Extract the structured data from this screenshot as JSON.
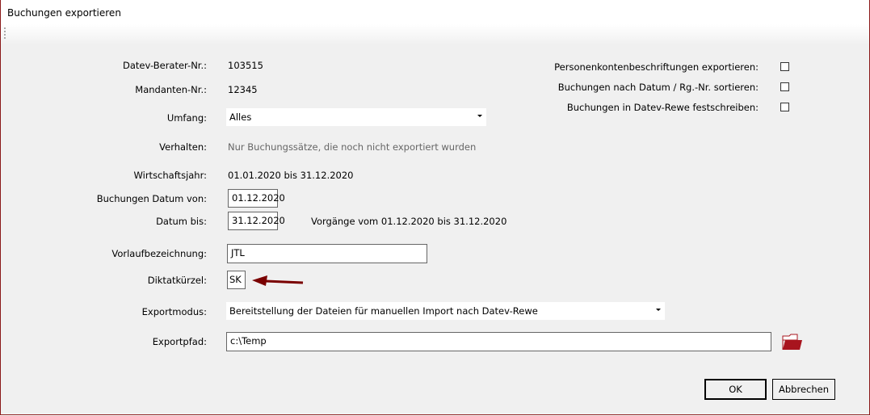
{
  "window": {
    "title": "Buchungen exportieren"
  },
  "form": {
    "berater_label": "Datev-Berater-Nr.:",
    "berater_value": "103515",
    "mandant_label": "Mandanten-Nr.:",
    "mandant_value": "12345",
    "umfang_label": "Umfang:",
    "umfang_value": "Alles",
    "verhalten_label": "Verhalten:",
    "verhalten_value": "Nur Buchungssätze, die noch nicht exportiert wurden",
    "wj_label": "Wirtschaftsjahr:",
    "wj_value": "01.01.2020 bis 31.12.2020",
    "von_label": "Buchungen Datum von:",
    "von_value": "01.12.2020",
    "bis_label": "Datum bis:",
    "bis_value": "31.12.2020",
    "vorgaenge": "Vorgänge vom 01.12.2020 bis 31.12.2020",
    "vorlauf_label": "Vorlaufbezeichnung:",
    "vorlauf_value": "JTL",
    "diktat_label": "Diktatkürzel:",
    "diktat_value": "SK",
    "modus_label": "Exportmodus:",
    "modus_value": "Bereitstellung der Dateien für manuellen Import nach Datev-Rewe",
    "pfad_label": "Exportpfad:",
    "pfad_value": "c:\\Temp"
  },
  "options": [
    {
      "label": "Personenkontenbeschriftungen exportieren:",
      "checked": false
    },
    {
      "label": "Buchungen nach Datum / Rg.-Nr. sortieren:",
      "checked": false
    },
    {
      "label": "Buchungen in Datev-Rewe festschreiben:",
      "checked": false
    }
  ],
  "buttons": {
    "ok": "OK",
    "cancel": "Abbrechen"
  },
  "colors": {
    "accent": "#8b1a1a",
    "folder": "#a8141e",
    "arrow": "#7a0000"
  }
}
